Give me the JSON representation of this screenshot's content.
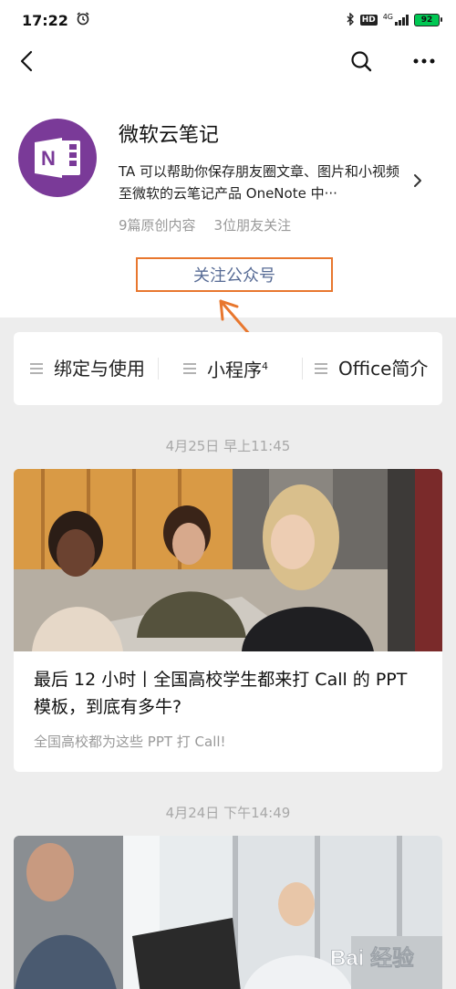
{
  "status_bar": {
    "time": "17:22",
    "hd": "HD",
    "network": "4G",
    "battery": "92"
  },
  "account": {
    "name": "微软云笔记",
    "description": "TA 可以帮助你保存朋友圈文章、图片和小视频至微软的云笔记产品 OneNote 中···",
    "original_count": "9篇原创内容",
    "friends_following": "3位朋友关注",
    "follow_label": "关注公众号"
  },
  "menu": [
    {
      "label": "绑定与使用"
    },
    {
      "label": "小程序",
      "badge": "4"
    },
    {
      "label": "Office简介"
    }
  ],
  "articles": [
    {
      "date": "4月25日 早上11:45",
      "title": "最后 12 小时丨全国高校学生都来打 Call 的 PPT 模板，到底有多牛?",
      "summary": "全国高校都为这些 PPT 打 Call!"
    },
    {
      "date": "4月24日 下午14:49"
    }
  ],
  "watermark": {
    "text": "Bai 经验"
  },
  "colors": {
    "accent_orange": "#e8772e",
    "link_blue": "#576b95",
    "avatar_purple": "#7a3a98",
    "page_gray": "#ededed"
  },
  "icons": [
    "back-icon",
    "search-icon",
    "more-icon",
    "onenote-logo",
    "chevron-right-icon",
    "menu-lines-icon"
  ]
}
